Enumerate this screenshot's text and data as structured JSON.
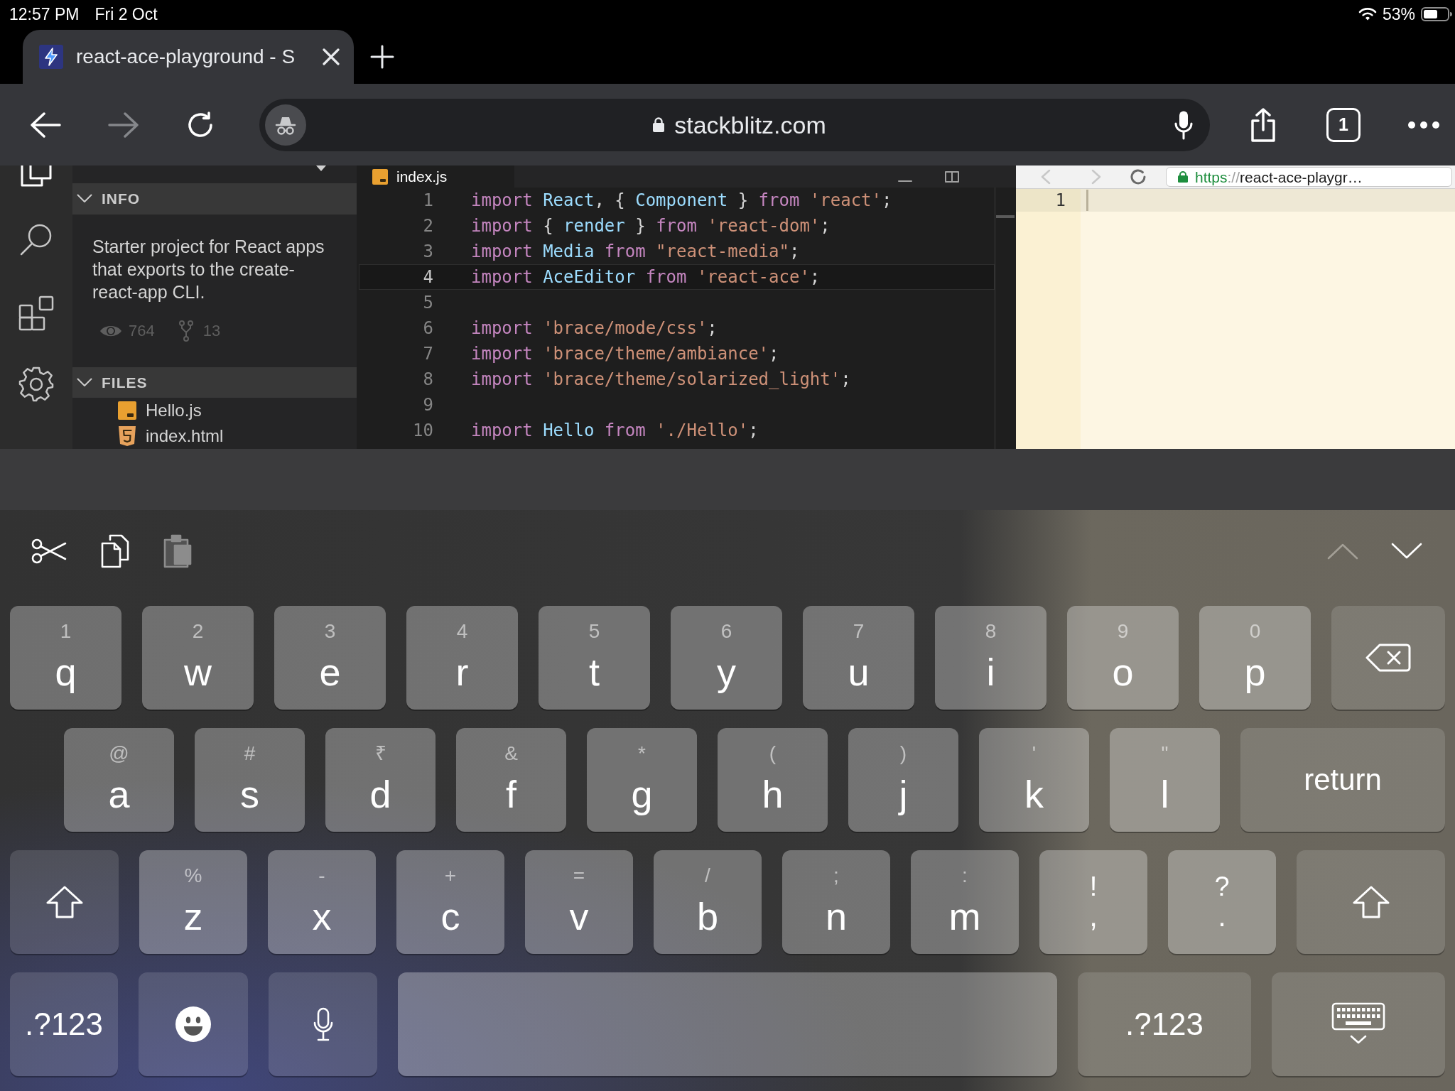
{
  "status_bar": {
    "time": "12:57 PM",
    "date": "Fri 2 Oct",
    "battery": "53%"
  },
  "browser": {
    "tabs": [
      {
        "title": "react-ace-playground - S",
        "selected": true
      }
    ],
    "nav_buttons": [
      {
        "kind": "back",
        "disabled": false
      },
      {
        "kind": "forward",
        "disabled": true
      },
      {
        "kind": "reload",
        "disabled": false
      }
    ],
    "url": "stackblitz.com",
    "tab_count": "1"
  },
  "sidebar": {
    "info": {
      "title": "INFO",
      "expanded": true,
      "description": "Starter project for React apps that exports to the create-react-app CLI.",
      "views": "764",
      "forks": "13"
    },
    "files": {
      "title": "FILES",
      "expanded": true,
      "items": [
        {
          "name": "Hello.js",
          "kind": "js"
        },
        {
          "name": "index.html",
          "kind": "html"
        }
      ]
    }
  },
  "editor": {
    "tab": "index.js",
    "lines": [
      {
        "number": "1",
        "current": false,
        "tokens": [
          {
            "kind": "keyword",
            "text": "import "
          },
          {
            "kind": "name",
            "text": "React"
          },
          {
            "kind": "punct",
            "text": ", { "
          },
          {
            "kind": "name",
            "text": "Component"
          },
          {
            "kind": "punct",
            "text": " } "
          },
          {
            "kind": "keyword",
            "text": "from "
          },
          {
            "kind": "string",
            "text": "'react'"
          },
          {
            "kind": "punct",
            "text": ";"
          }
        ]
      },
      {
        "number": "2",
        "current": false,
        "tokens": [
          {
            "kind": "keyword",
            "text": "import"
          },
          {
            "kind": "punct",
            "text": " { "
          },
          {
            "kind": "name",
            "text": "render"
          },
          {
            "kind": "punct",
            "text": " } "
          },
          {
            "kind": "keyword",
            "text": "from "
          },
          {
            "kind": "string",
            "text": "'react-dom'"
          },
          {
            "kind": "punct",
            "text": ";"
          }
        ]
      },
      {
        "number": "3",
        "current": false,
        "tokens": [
          {
            "kind": "keyword",
            "text": "import "
          },
          {
            "kind": "name",
            "text": "Media"
          },
          {
            "kind": "keyword",
            "text": " from "
          },
          {
            "kind": "string",
            "text": "\"react-media\""
          },
          {
            "kind": "punct",
            "text": ";"
          }
        ]
      },
      {
        "number": "4",
        "current": true,
        "tokens": [
          {
            "kind": "keyword",
            "text": "import "
          },
          {
            "kind": "name",
            "text": "AceEditor"
          },
          {
            "kind": "keyword",
            "text": " from "
          },
          {
            "kind": "string",
            "text": "'react-ace'"
          },
          {
            "kind": "punct",
            "text": ";"
          }
        ]
      },
      {
        "number": "5",
        "current": false
      },
      {
        "number": "6",
        "current": false,
        "tokens": [
          {
            "kind": "keyword",
            "text": "import "
          },
          {
            "kind": "string",
            "text": "'brace/mode/css'"
          },
          {
            "kind": "punct",
            "text": ";"
          }
        ]
      },
      {
        "number": "7",
        "current": false,
        "tokens": [
          {
            "kind": "keyword",
            "text": "import "
          },
          {
            "kind": "string",
            "text": "'brace/theme/ambiance'"
          },
          {
            "kind": "punct",
            "text": ";"
          }
        ]
      },
      {
        "number": "8",
        "current": false,
        "tokens": [
          {
            "kind": "keyword",
            "text": "import "
          },
          {
            "kind": "string",
            "text": "'brace/theme/solarized_light'"
          },
          {
            "kind": "punct",
            "text": ";"
          }
        ]
      },
      {
        "number": "9",
        "current": false
      },
      {
        "number": "10",
        "current": false,
        "tokens": [
          {
            "kind": "keyword",
            "text": "import "
          },
          {
            "kind": "name",
            "text": "Hello"
          },
          {
            "kind": "keyword",
            "text": " from "
          },
          {
            "kind": "string",
            "text": "'./Hello'"
          },
          {
            "kind": "punct",
            "text": ";"
          }
        ]
      }
    ]
  },
  "preview": {
    "url": {
      "scheme": "https",
      "separator": "://",
      "rest": "react-ace-playgr…"
    },
    "line_number": "1"
  },
  "keyboard": {
    "tools": [
      {
        "kind": "cut",
        "disabled": false
      },
      {
        "kind": "copy",
        "disabled": false
      },
      {
        "kind": "paste",
        "disabled": true
      }
    ],
    "arrows": [
      {
        "kind": "up",
        "disabled": true
      },
      {
        "kind": "down",
        "disabled": false
      }
    ],
    "rows": [
      [
        {
          "kind": "letter",
          "hint": "1",
          "label": "q"
        },
        {
          "kind": "letter",
          "hint": "2",
          "label": "w"
        },
        {
          "kind": "letter",
          "hint": "3",
          "label": "e"
        },
        {
          "kind": "letter",
          "hint": "4",
          "label": "r"
        },
        {
          "kind": "letter",
          "hint": "5",
          "label": "t"
        },
        {
          "kind": "letter",
          "hint": "6",
          "label": "y"
        },
        {
          "kind": "letter",
          "hint": "7",
          "label": "u"
        },
        {
          "kind": "letter",
          "hint": "8",
          "label": "i"
        },
        {
          "kind": "letter",
          "hint": "9",
          "label": "o"
        },
        {
          "kind": "letter",
          "hint": "0",
          "label": "p"
        },
        {
          "kind": "backspace"
        }
      ],
      [
        {
          "kind": "letter",
          "hint": "@",
          "label": "a"
        },
        {
          "kind": "letter",
          "hint": "#",
          "label": "s"
        },
        {
          "kind": "letter",
          "hint": "₹",
          "label": "d"
        },
        {
          "kind": "letter",
          "hint": "&",
          "label": "f"
        },
        {
          "kind": "letter",
          "hint": "*",
          "label": "g"
        },
        {
          "kind": "letter",
          "hint": "(",
          "label": "h"
        },
        {
          "kind": "letter",
          "hint": ")",
          "label": "j"
        },
        {
          "kind": "letter",
          "hint": "'",
          "label": "k"
        },
        {
          "kind": "letter",
          "hint": "\"",
          "label": "l"
        },
        {
          "kind": "return",
          "label": "return"
        }
      ],
      [
        {
          "kind": "shift"
        },
        {
          "kind": "letter",
          "hint": "%",
          "label": "z"
        },
        {
          "kind": "letter",
          "hint": "-",
          "label": "x"
        },
        {
          "kind": "letter",
          "hint": "+",
          "label": "c"
        },
        {
          "kind": "letter",
          "hint": "=",
          "label": "v"
        },
        {
          "kind": "letter",
          "hint": "/",
          "label": "b"
        },
        {
          "kind": "letter",
          "hint": ";",
          "label": "n"
        },
        {
          "kind": "letter",
          "hint": ":",
          "label": "m"
        },
        {
          "kind": "dual",
          "hint": "!",
          "label": ","
        },
        {
          "kind": "dual",
          "hint": "?",
          "label": "."
        },
        {
          "kind": "shift"
        }
      ],
      [
        {
          "kind": "symbols",
          "label": ".?123"
        },
        {
          "kind": "emoji"
        },
        {
          "kind": "dictation"
        },
        {
          "kind": "space"
        },
        {
          "kind": "symbols",
          "label": ".?123"
        },
        {
          "kind": "dismiss"
        }
      ]
    ]
  }
}
